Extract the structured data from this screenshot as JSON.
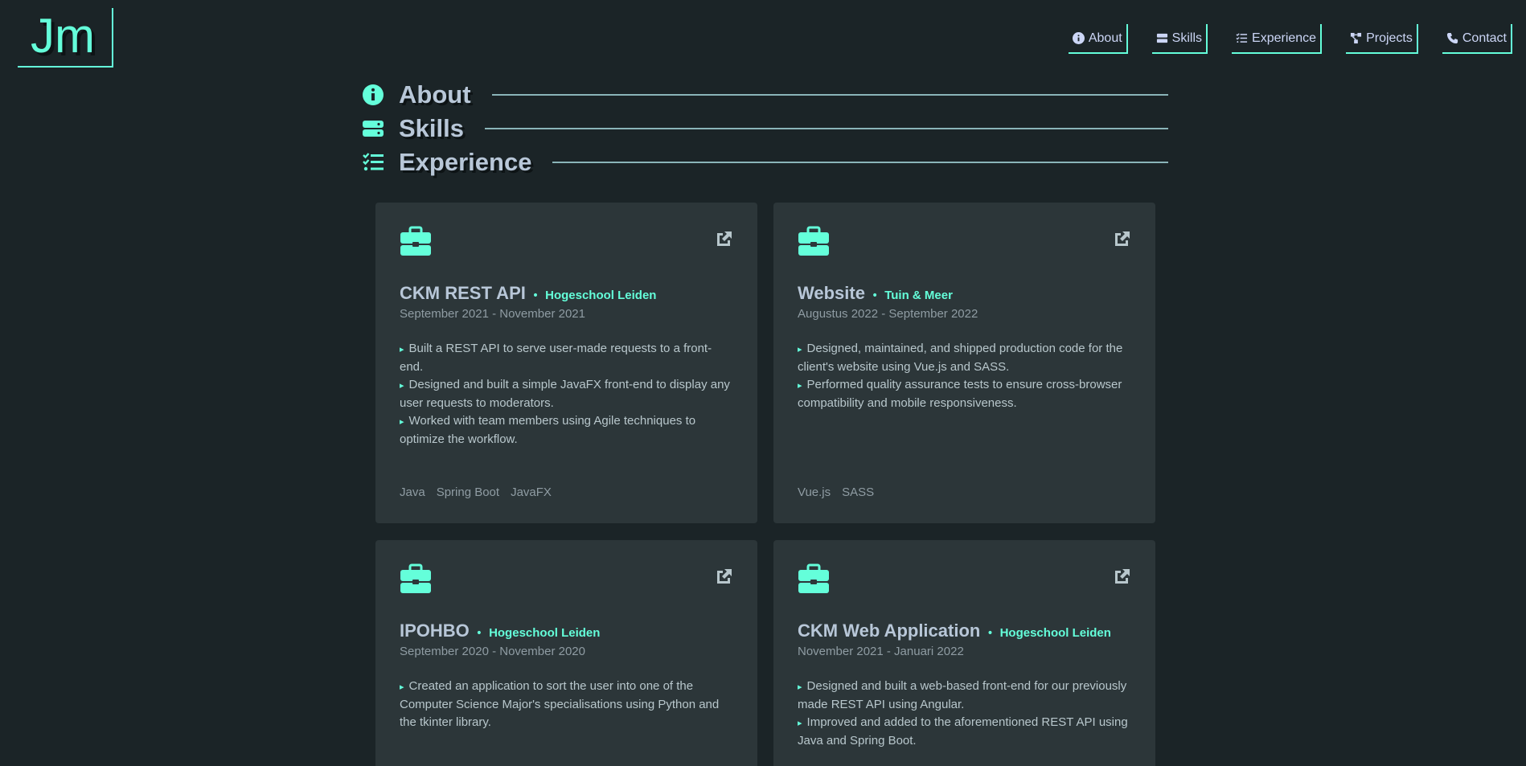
{
  "logo": {
    "text": "Jm"
  },
  "nav": [
    {
      "label": "About",
      "icon": "info-circle-icon"
    },
    {
      "label": "Skills",
      "icon": "server-icon"
    },
    {
      "label": "Experience",
      "icon": "list-check-icon"
    },
    {
      "label": "Projects",
      "icon": "diagram-icon"
    },
    {
      "label": "Contact",
      "icon": "phone-icon"
    }
  ],
  "sections": [
    {
      "title": "About",
      "icon": "info-circle-icon"
    },
    {
      "title": "Skills",
      "icon": "server-icon"
    },
    {
      "title": "Experience",
      "icon": "list-check-icon"
    }
  ],
  "accent_color": "#64ffda",
  "background_color": "#1b2427",
  "card_color": "#2c3639",
  "experience": [
    {
      "title": "CKM REST API",
      "company": "Hogeschool Leiden",
      "date": "September 2021 - November 2021",
      "bullets": [
        "Built a REST API to serve user-made requests to a front-end.",
        "Designed and built a simple JavaFX front-end to display any user requests to moderators.",
        "Worked with team members using Agile techniques to optimize the workflow."
      ],
      "tags": [
        "Java",
        "Spring Boot",
        "JavaFX"
      ]
    },
    {
      "title": "Website",
      "company": "Tuin & Meer",
      "date": "Augustus 2022 - September 2022",
      "bullets": [
        "Designed, maintained, and shipped production code for the client's website using Vue.js and SASS.",
        "Performed quality assurance tests to ensure cross-browser compatibility and mobile responsiveness."
      ],
      "tags": [
        "Vue.js",
        "SASS"
      ]
    },
    {
      "title": "IPOHBO",
      "company": "Hogeschool Leiden",
      "date": "September 2020 - November 2020",
      "bullets": [
        "Created an application to sort the user into one of the Computer Science Major's specialisations using Python and the tkinter library."
      ],
      "tags": []
    },
    {
      "title": "CKM Web Application",
      "company": "Hogeschool Leiden",
      "date": "November 2021 - Januari 2022",
      "bullets": [
        "Designed and built a web-based front-end for our previously made REST API using Angular.",
        "Improved and added to the aforementioned REST API using Java and Spring Boot."
      ],
      "tags": []
    }
  ]
}
